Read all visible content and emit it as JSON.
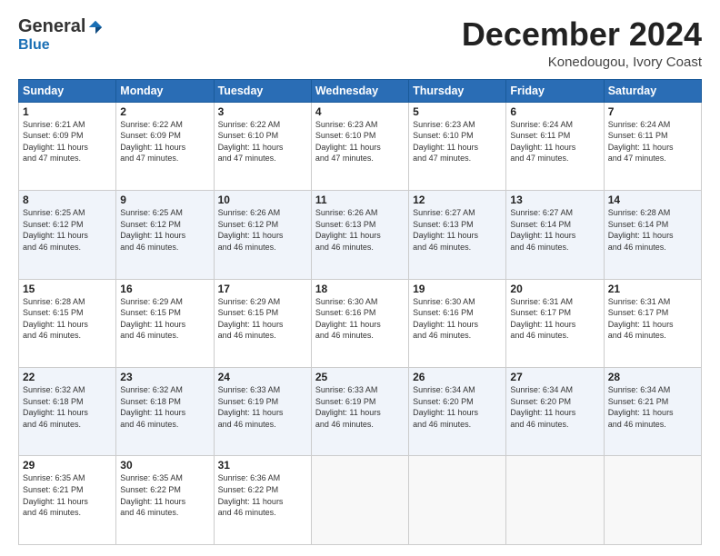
{
  "header": {
    "logo_general": "General",
    "logo_blue": "Blue",
    "month_title": "December 2024",
    "location": "Konedougou, Ivory Coast"
  },
  "days_of_week": [
    "Sunday",
    "Monday",
    "Tuesday",
    "Wednesday",
    "Thursday",
    "Friday",
    "Saturday"
  ],
  "weeks": [
    [
      {
        "day": "1",
        "sunrise": "6:21 AM",
        "sunset": "6:09 PM",
        "daylight": "11 hours and 47 minutes."
      },
      {
        "day": "2",
        "sunrise": "6:22 AM",
        "sunset": "6:09 PM",
        "daylight": "11 hours and 47 minutes."
      },
      {
        "day": "3",
        "sunrise": "6:22 AM",
        "sunset": "6:10 PM",
        "daylight": "11 hours and 47 minutes."
      },
      {
        "day": "4",
        "sunrise": "6:23 AM",
        "sunset": "6:10 PM",
        "daylight": "11 hours and 47 minutes."
      },
      {
        "day": "5",
        "sunrise": "6:23 AM",
        "sunset": "6:10 PM",
        "daylight": "11 hours and 47 minutes."
      },
      {
        "day": "6",
        "sunrise": "6:24 AM",
        "sunset": "6:11 PM",
        "daylight": "11 hours and 47 minutes."
      },
      {
        "day": "7",
        "sunrise": "6:24 AM",
        "sunset": "6:11 PM",
        "daylight": "11 hours and 47 minutes."
      }
    ],
    [
      {
        "day": "8",
        "sunrise": "6:25 AM",
        "sunset": "6:12 PM",
        "daylight": "11 hours and 46 minutes."
      },
      {
        "day": "9",
        "sunrise": "6:25 AM",
        "sunset": "6:12 PM",
        "daylight": "11 hours and 46 minutes."
      },
      {
        "day": "10",
        "sunrise": "6:26 AM",
        "sunset": "6:12 PM",
        "daylight": "11 hours and 46 minutes."
      },
      {
        "day": "11",
        "sunrise": "6:26 AM",
        "sunset": "6:13 PM",
        "daylight": "11 hours and 46 minutes."
      },
      {
        "day": "12",
        "sunrise": "6:27 AM",
        "sunset": "6:13 PM",
        "daylight": "11 hours and 46 minutes."
      },
      {
        "day": "13",
        "sunrise": "6:27 AM",
        "sunset": "6:14 PM",
        "daylight": "11 hours and 46 minutes."
      },
      {
        "day": "14",
        "sunrise": "6:28 AM",
        "sunset": "6:14 PM",
        "daylight": "11 hours and 46 minutes."
      }
    ],
    [
      {
        "day": "15",
        "sunrise": "6:28 AM",
        "sunset": "6:15 PM",
        "daylight": "11 hours and 46 minutes."
      },
      {
        "day": "16",
        "sunrise": "6:29 AM",
        "sunset": "6:15 PM",
        "daylight": "11 hours and 46 minutes."
      },
      {
        "day": "17",
        "sunrise": "6:29 AM",
        "sunset": "6:15 PM",
        "daylight": "11 hours and 46 minutes."
      },
      {
        "day": "18",
        "sunrise": "6:30 AM",
        "sunset": "6:16 PM",
        "daylight": "11 hours and 46 minutes."
      },
      {
        "day": "19",
        "sunrise": "6:30 AM",
        "sunset": "6:16 PM",
        "daylight": "11 hours and 46 minutes."
      },
      {
        "day": "20",
        "sunrise": "6:31 AM",
        "sunset": "6:17 PM",
        "daylight": "11 hours and 46 minutes."
      },
      {
        "day": "21",
        "sunrise": "6:31 AM",
        "sunset": "6:17 PM",
        "daylight": "11 hours and 46 minutes."
      }
    ],
    [
      {
        "day": "22",
        "sunrise": "6:32 AM",
        "sunset": "6:18 PM",
        "daylight": "11 hours and 46 minutes."
      },
      {
        "day": "23",
        "sunrise": "6:32 AM",
        "sunset": "6:18 PM",
        "daylight": "11 hours and 46 minutes."
      },
      {
        "day": "24",
        "sunrise": "6:33 AM",
        "sunset": "6:19 PM",
        "daylight": "11 hours and 46 minutes."
      },
      {
        "day": "25",
        "sunrise": "6:33 AM",
        "sunset": "6:19 PM",
        "daylight": "11 hours and 46 minutes."
      },
      {
        "day": "26",
        "sunrise": "6:34 AM",
        "sunset": "6:20 PM",
        "daylight": "11 hours and 46 minutes."
      },
      {
        "day": "27",
        "sunrise": "6:34 AM",
        "sunset": "6:20 PM",
        "daylight": "11 hours and 46 minutes."
      },
      {
        "day": "28",
        "sunrise": "6:34 AM",
        "sunset": "6:21 PM",
        "daylight": "11 hours and 46 minutes."
      }
    ],
    [
      {
        "day": "29",
        "sunrise": "6:35 AM",
        "sunset": "6:21 PM",
        "daylight": "11 hours and 46 minutes."
      },
      {
        "day": "30",
        "sunrise": "6:35 AM",
        "sunset": "6:22 PM",
        "daylight": "11 hours and 46 minutes."
      },
      {
        "day": "31",
        "sunrise": "6:36 AM",
        "sunset": "6:22 PM",
        "daylight": "11 hours and 46 minutes."
      },
      null,
      null,
      null,
      null
    ]
  ]
}
